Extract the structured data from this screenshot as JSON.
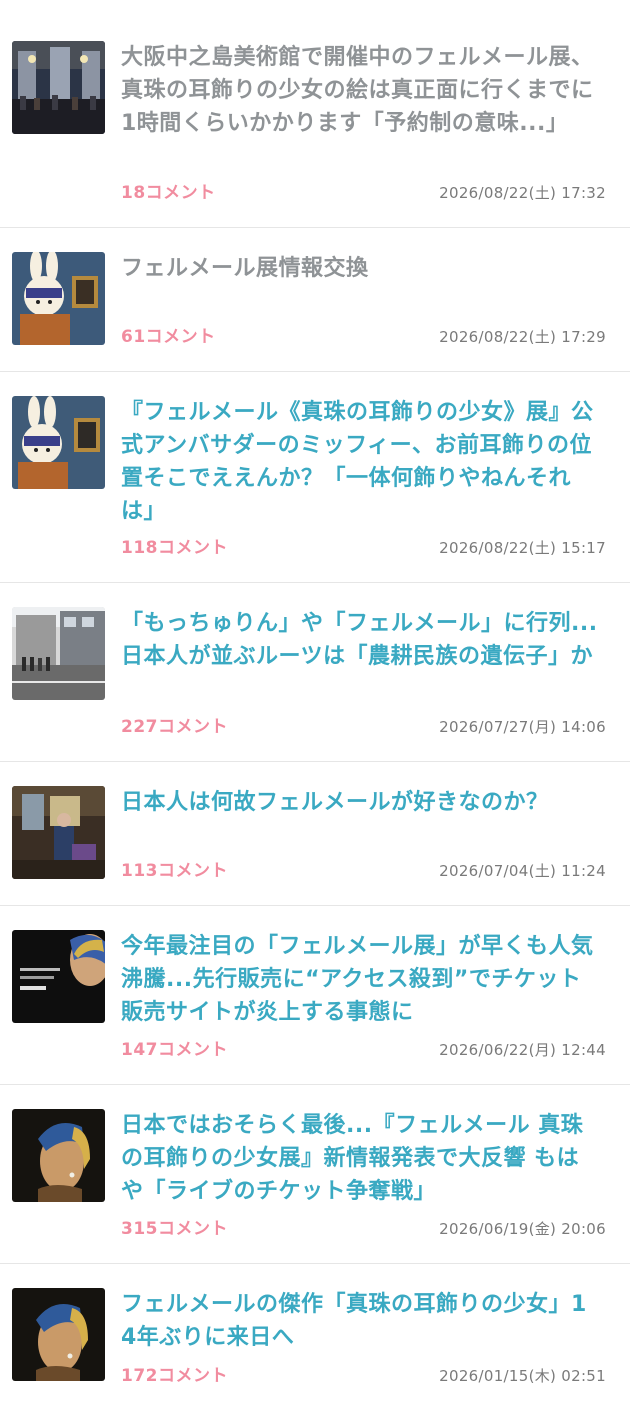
{
  "articles": [
    {
      "title": "大阪中之島美術館で開催中のフェルメール展、真珠の耳飾りの少女の絵は真正面に行くまでに1時間くらいかかります「予約制の意味...」",
      "comments": "18コメント",
      "date": "2026/08/22(土) 17:32",
      "visited": true,
      "thumb": "museum-hall-image"
    },
    {
      "title": "フェルメール展情報交換",
      "comments": "61コメント",
      "date": "2026/08/22(土) 17:29",
      "visited": true,
      "thumb": "miffy-image"
    },
    {
      "title": "『フェルメール《真珠の耳飾りの少女》展』公式アンバサダーのミッフィー、お前耳飾りの位置そこでええんか？「一体何飾りやねんそれは」",
      "comments": "118コメント",
      "date": "2026/08/22(土) 15:17",
      "visited": false,
      "thumb": "miffy-image"
    },
    {
      "title": "「もっちゅりん」や「フェルメール」に行列...日本人が並ぶルーツは「農耕民族の遺伝子」か",
      "comments": "227コメント",
      "date": "2026/07/27(月) 14:06",
      "visited": false,
      "thumb": "street-queue-image"
    },
    {
      "title": "日本人は何故フェルメールが好きなのか？",
      "comments": "113コメント",
      "date": "2026/07/04(土) 11:24",
      "visited": false,
      "thumb": "painting-scene-image"
    },
    {
      "title": "今年最注目の「フェルメール展」が早くも人気沸騰...先行販売に“アクセス殺到”でチケット販売サイトが炎上する事態に",
      "comments": "147コメント",
      "date": "2026/06/22(月) 12:44",
      "visited": false,
      "thumb": "exhibition-poster-image"
    },
    {
      "title": "日本ではおそらく最後...『フェルメール 真珠の耳飾りの少女展』新情報発表で大反響 もはや「ライブのチケット争奪戦」",
      "comments": "315コメント",
      "date": "2026/06/19(金) 20:06",
      "visited": false,
      "thumb": "pearl-earring-girl-image"
    },
    {
      "title": "フェルメールの傑作「真珠の耳飾りの少女」14年ぶりに来日へ",
      "comments": "172コメント",
      "date": "2026/01/15(木) 02:51",
      "visited": false,
      "thumb": "pearl-earring-girl-image"
    }
  ],
  "thumb_colors": {
    "visited_title": "#8f9396",
    "link_title": "#3aa9c2",
    "comment_count": "#f18c9f"
  }
}
